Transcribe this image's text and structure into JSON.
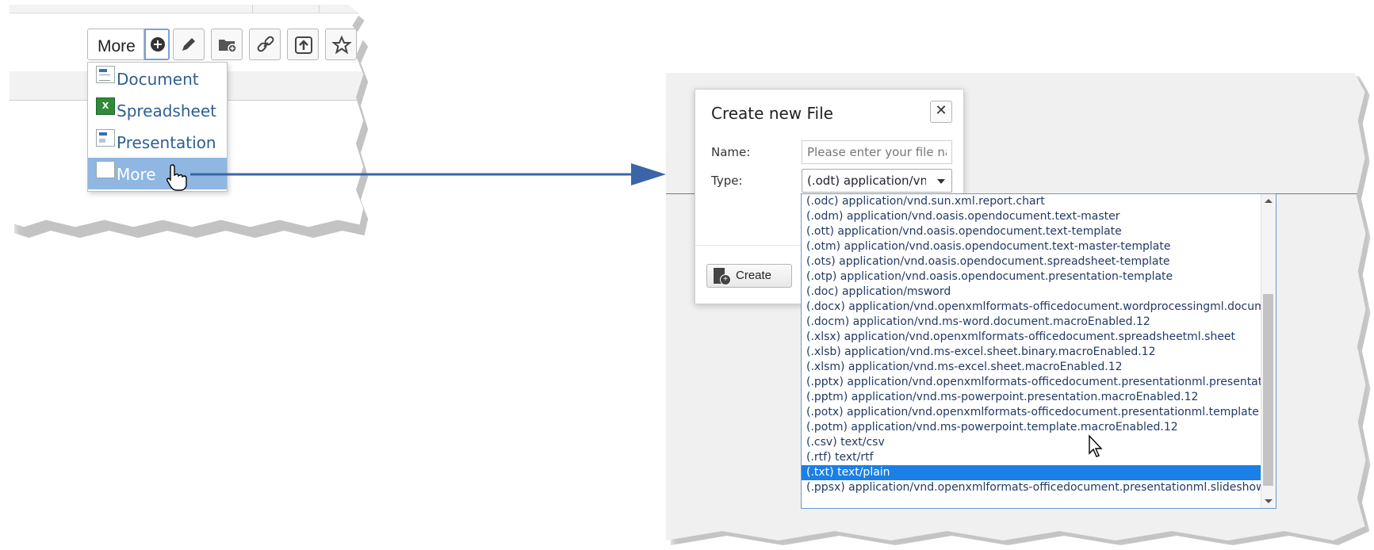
{
  "toolbar": {
    "more_label": "More",
    "buttons": [
      "plus-icon",
      "pencil-icon",
      "folder-add-icon",
      "link-icon",
      "upload-icon",
      "star-icon"
    ]
  },
  "dropdown": {
    "items": [
      {
        "label": "Document",
        "icon": "document-icon"
      },
      {
        "label": "Spreadsheet",
        "icon": "spreadsheet-icon"
      },
      {
        "label": "Presentation",
        "icon": "presentation-icon"
      },
      {
        "label": "More",
        "icon": "blank-file-icon",
        "selected": true
      }
    ]
  },
  "dialog": {
    "title": "Create new File",
    "close_glyph": "✕",
    "name_label": "Name:",
    "name_placeholder": "Please enter your file name",
    "type_label": "Type:",
    "type_value": "(.odt) application/vnd.oasis.opendocument.text",
    "create_label": "Create"
  },
  "type_options": [
    "(.odc) application/vnd.sun.xml.report.chart",
    "(.odm) application/vnd.oasis.opendocument.text-master",
    "(.ott) application/vnd.oasis.opendocument.text-template",
    "(.otm) application/vnd.oasis.opendocument.text-master-template",
    "(.ots) application/vnd.oasis.opendocument.spreadsheet-template",
    "(.otp) application/vnd.oasis.opendocument.presentation-template",
    "(.doc) application/msword",
    "(.docx) application/vnd.openxmlformats-officedocument.wordprocessingml.document",
    "(.docm) application/vnd.ms-word.document.macroEnabled.12",
    "(.xlsx) application/vnd.openxmlformats-officedocument.spreadsheetml.sheet",
    "(.xlsb) application/vnd.ms-excel.sheet.binary.macroEnabled.12",
    "(.xlsm) application/vnd.ms-excel.sheet.macroEnabled.12",
    "(.pptx) application/vnd.openxmlformats-officedocument.presentationml.presentation",
    "(.pptm) application/vnd.ms-powerpoint.presentation.macroEnabled.12",
    "(.potx) application/vnd.openxmlformats-officedocument.presentationml.template",
    "(.potm) application/vnd.ms-powerpoint.template.macroEnabled.12",
    "(.csv) text/csv",
    "(.rtf) text/rtf",
    "(.txt) text/plain",
    "(.ppsx) application/vnd.openxmlformats-officedocument.presentationml.slideshow"
  ],
  "selected_option_index": 18,
  "colors": {
    "accent": "#1a7fe6",
    "arrow": "#3a66a8",
    "menu_selected": "#8fb7e2",
    "link_text": "#2e5f94"
  }
}
